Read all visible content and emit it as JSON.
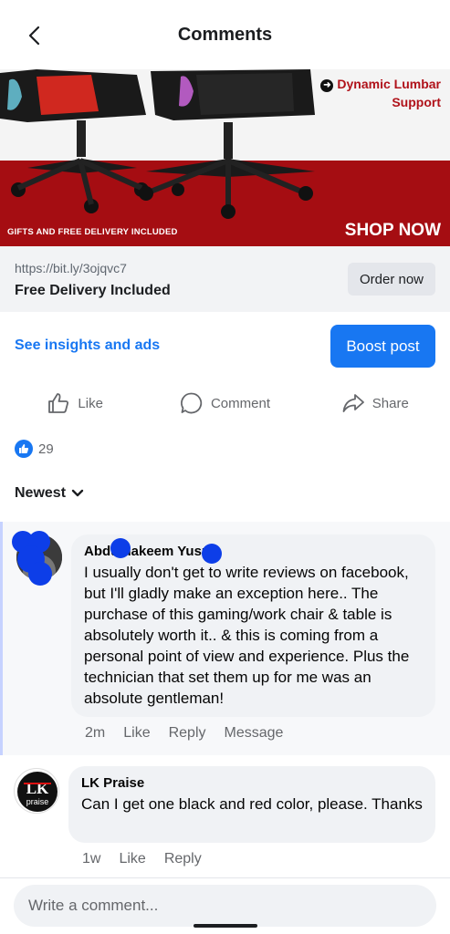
{
  "header": {
    "title": "Comments"
  },
  "ad": {
    "lumbar_line1": "Dynamic Lumbar",
    "lumbar_line2": "Support",
    "gifts_text": "GIFTS AND FREE DELIVERY INCLUDED",
    "shop_text": "SHOP NOW"
  },
  "link": {
    "url": "https://bit.ly/3ojqvc7",
    "title": "Free Delivery Included",
    "cta": "Order now"
  },
  "insights": {
    "link_text": "See insights and ads",
    "boost_label": "Boost post"
  },
  "actions": {
    "like": "Like",
    "comment": "Comment",
    "share": "Share"
  },
  "reactions": {
    "count": "29"
  },
  "sort": {
    "label": "Newest"
  },
  "comments": [
    {
      "author": "Abdulhakeem Yusuf",
      "text": "I usually don't get to write reviews on facebook, but I'll gladly make an exception here.. The purchase of this gaming/work chair & table is absolutely worth it.. & this is coming from a personal point of view and experience. Plus the technician that set them up for me was an absolute gentleman!",
      "time": "2m",
      "like": "Like",
      "reply": "Reply",
      "message": "Message"
    },
    {
      "author": "LK Praise",
      "avatar_text": "LK",
      "avatar_sub": "praise",
      "text": "Can I get one black and red color, please. Thanks",
      "time": "1w",
      "like": "Like",
      "reply": "Reply"
    }
  ],
  "footer": {
    "placeholder": "Write a comment..."
  },
  "colors": {
    "accent": "#1877f2",
    "ad_red": "#a50d12",
    "redaction": "#0d3ee8"
  }
}
